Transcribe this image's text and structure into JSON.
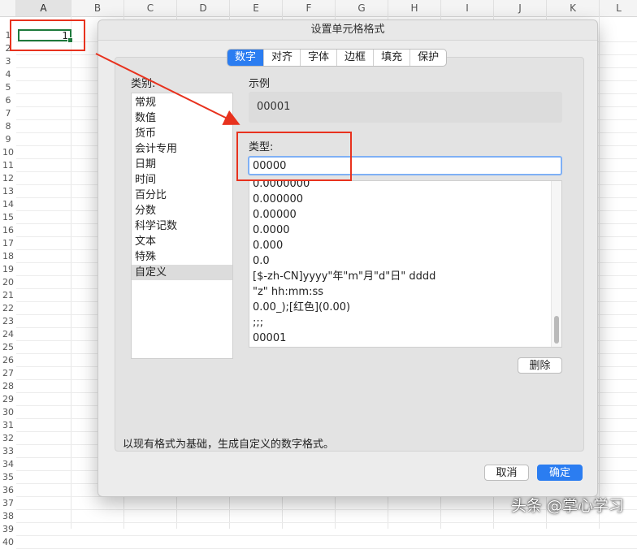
{
  "sheet": {
    "columns": [
      "A",
      "B",
      "C",
      "D",
      "E",
      "F",
      "G",
      "H",
      "I",
      "J",
      "K",
      "L"
    ],
    "rows": [
      "1",
      "2",
      "3",
      "4",
      "5",
      "6",
      "7",
      "8",
      "9",
      "10",
      "11",
      "12",
      "13",
      "14",
      "15",
      "16",
      "17",
      "18",
      "19",
      "20",
      "21",
      "22",
      "23",
      "24",
      "25",
      "26",
      "27",
      "28",
      "29",
      "30",
      "31",
      "32",
      "33",
      "34",
      "35",
      "36",
      "37",
      "38",
      "39",
      "40"
    ],
    "cell_a2_value": "1"
  },
  "dialog": {
    "title": "设置单元格格式",
    "tabs": [
      "数字",
      "对齐",
      "字体",
      "边框",
      "填充",
      "保护"
    ],
    "active_tab": "数字",
    "category_label": "类别:",
    "categories": [
      "常规",
      "数值",
      "货币",
      "会计专用",
      "日期",
      "时间",
      "百分比",
      "分数",
      "科学记数",
      "文本",
      "特殊",
      "自定义"
    ],
    "selected_category": "自定义",
    "sample_label": "示例",
    "sample_value": "00001",
    "type_label": "类型:",
    "type_value": "00000",
    "formats": [
      "0.0000000",
      "0.000000",
      "0.00000",
      "0.0000",
      "0.000",
      "0.0",
      "[$-zh-CN]yyyy\"年\"m\"月\"d\"日\" dddd",
      "\"z\" hh:mm:ss",
      "0.00_);[红色](0.00)",
      ";;;",
      "00001"
    ],
    "delete_button": "删除",
    "description": "以现有格式为基础，生成自定义的数字格式。",
    "cancel_button": "取消",
    "ok_button": "确定"
  },
  "watermark": "头条 @掌心学习",
  "colors": {
    "accent": "#2b7df1",
    "annotation_red": "#e8321e",
    "selected_cell": "#1e7a3c"
  }
}
